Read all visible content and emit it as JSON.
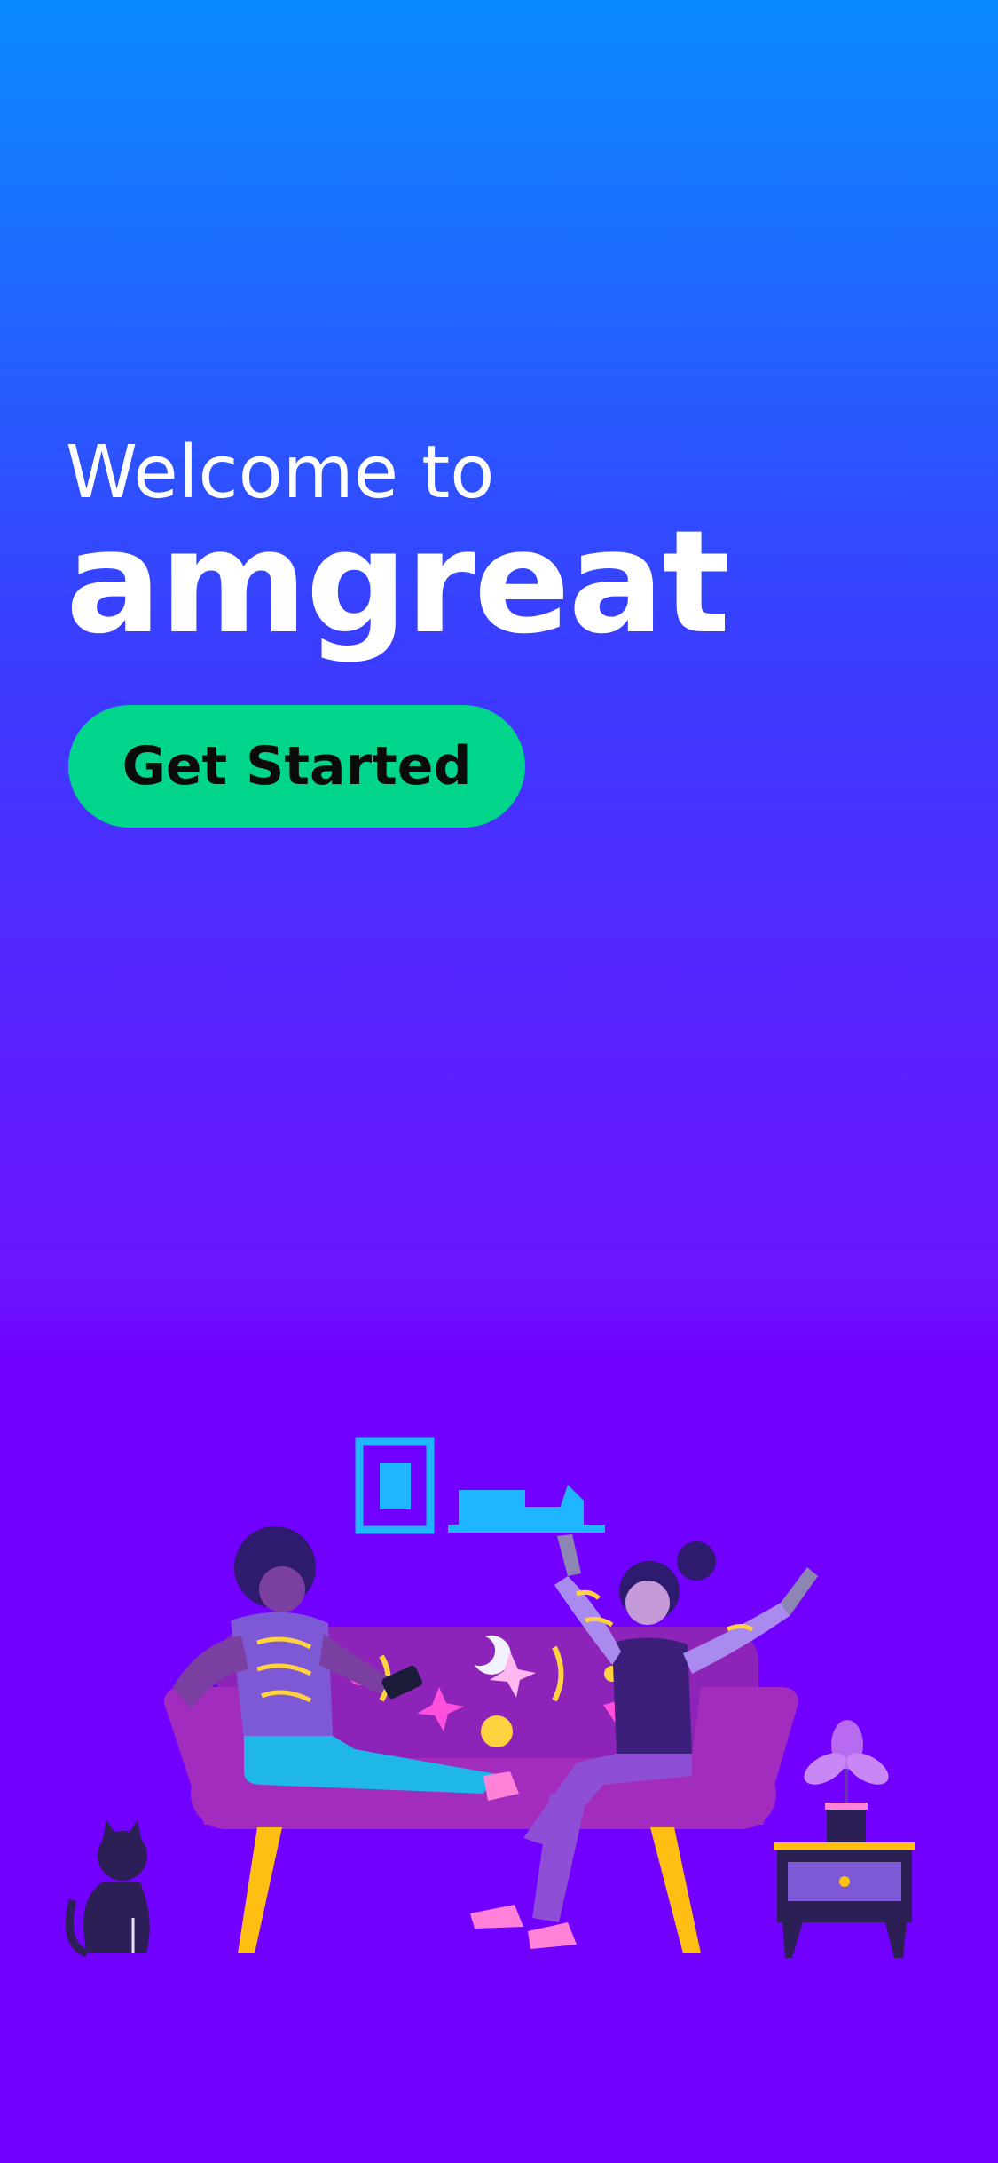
{
  "hero": {
    "welcome_text": "Welcome to",
    "brand_name": "amgreat"
  },
  "cta": {
    "label": "Get Started"
  },
  "colors": {
    "gradient_top": "#0a8bff",
    "gradient_bottom": "#7100ff",
    "cta_background": "#00d58b",
    "cta_text": "#0b0b0b",
    "text_primary": "#ffffff"
  },
  "illustration": {
    "icons": [
      "picture-frame-icon",
      "wall-shelf-icon",
      "couch-icon",
      "person-sitting-icon",
      "person-cheering-icon",
      "cat-icon",
      "side-table-icon",
      "potted-plant-icon"
    ]
  }
}
